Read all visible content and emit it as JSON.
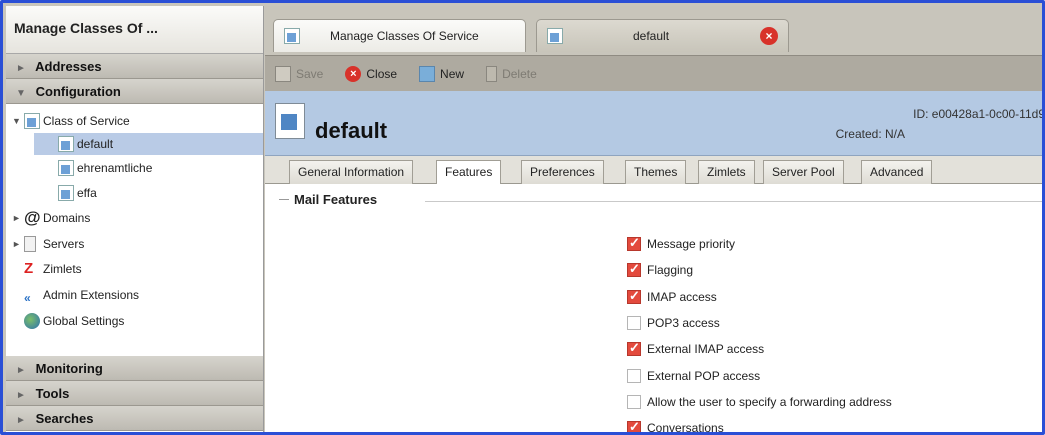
{
  "sidebar": {
    "header": "Manage Classes Of ...",
    "addresses": "Addresses",
    "configuration": "Configuration",
    "tree": {
      "class_of_service": "Class of Service",
      "default": "default",
      "ehrenamtliche": "ehrenamtliche",
      "effa": "effa",
      "domains": "Domains",
      "servers": "Servers",
      "zimlets": "Zimlets",
      "admin_extensions": "Admin Extensions",
      "global_settings": "Global Settings"
    },
    "monitoring": "Monitoring",
    "tools": "Tools",
    "searches": "Searches"
  },
  "tabs": {
    "manage": "Manage Classes Of Service",
    "default": "default"
  },
  "toolbar": {
    "save": "Save",
    "close": "Close",
    "new": "New",
    "delete": "Delete"
  },
  "header": {
    "title": "default",
    "id": "ID: e00428a1-0c00-11d9",
    "created": "Created: N/A"
  },
  "subtabs": [
    "General Information",
    "Features",
    "Preferences",
    "Themes",
    "Zimlets",
    "Server Pool",
    "Advanced"
  ],
  "section": {
    "title": "Mail Features"
  },
  "features": [
    {
      "label": "Message priority",
      "checked": true
    },
    {
      "label": "Flagging",
      "checked": true
    },
    {
      "label": "IMAP access",
      "checked": true
    },
    {
      "label": "POP3 access",
      "checked": false
    },
    {
      "label": "External IMAP access",
      "checked": true
    },
    {
      "label": "External POP access",
      "checked": false
    },
    {
      "label": "Allow the user to specify a forwarding address",
      "checked": false
    },
    {
      "label": "Conversations",
      "checked": true
    }
  ]
}
